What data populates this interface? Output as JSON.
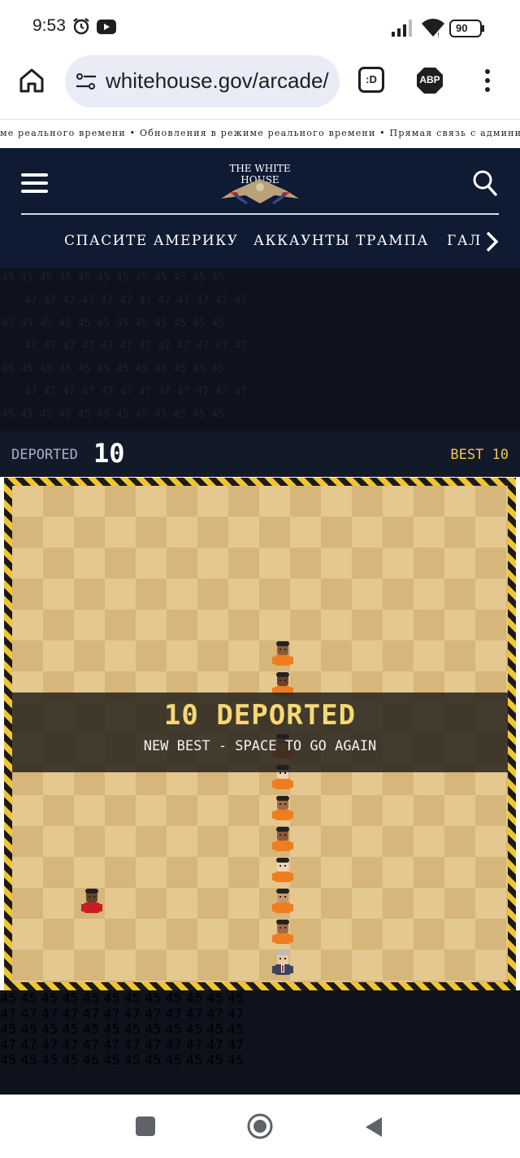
{
  "status_bar": {
    "time": "9:53",
    "battery": "90",
    "icons": [
      "alarm-icon",
      "youtube-icon",
      "signal-icon",
      "wifi-icon",
      "battery-icon"
    ]
  },
  "browser": {
    "url": "whitehouse.gov/arcade/",
    "icons": [
      "home-icon",
      "site-settings-icon",
      "tab-switcher-icon",
      "adblock-icon",
      "more-vert-icon"
    ],
    "tab_icon_text": ":D",
    "adblock_text": "ABP"
  },
  "ticker": {
    "text": "ме реального времени • Обновления в режиме реального времени • Прямая связь с админист"
  },
  "site_header": {
    "logo_text": "THE WHITE HOUSE",
    "nav": [
      "СПАСИТЕ АМЕРИКУ",
      "АККАУНТЫ ТРАМПА",
      "ГАЛ"
    ],
    "icons": [
      "menu-icon",
      "search-icon",
      "chevron-right-icon"
    ]
  },
  "pattern": {
    "a": "45",
    "b": "47"
  },
  "scoreboard": {
    "label": "DEPORTED",
    "value": "10",
    "best": "BEST 10"
  },
  "game_over": {
    "title": "10 DEPORTED",
    "subtitle": "NEW BEST - SPACE TO GO AGAIN"
  },
  "colors": {
    "navy": "#0f1a33",
    "accent_gold": "#f0c84a",
    "prisoner_orange": "#ee7d1f",
    "hazard_yellow": "#f2c530"
  }
}
